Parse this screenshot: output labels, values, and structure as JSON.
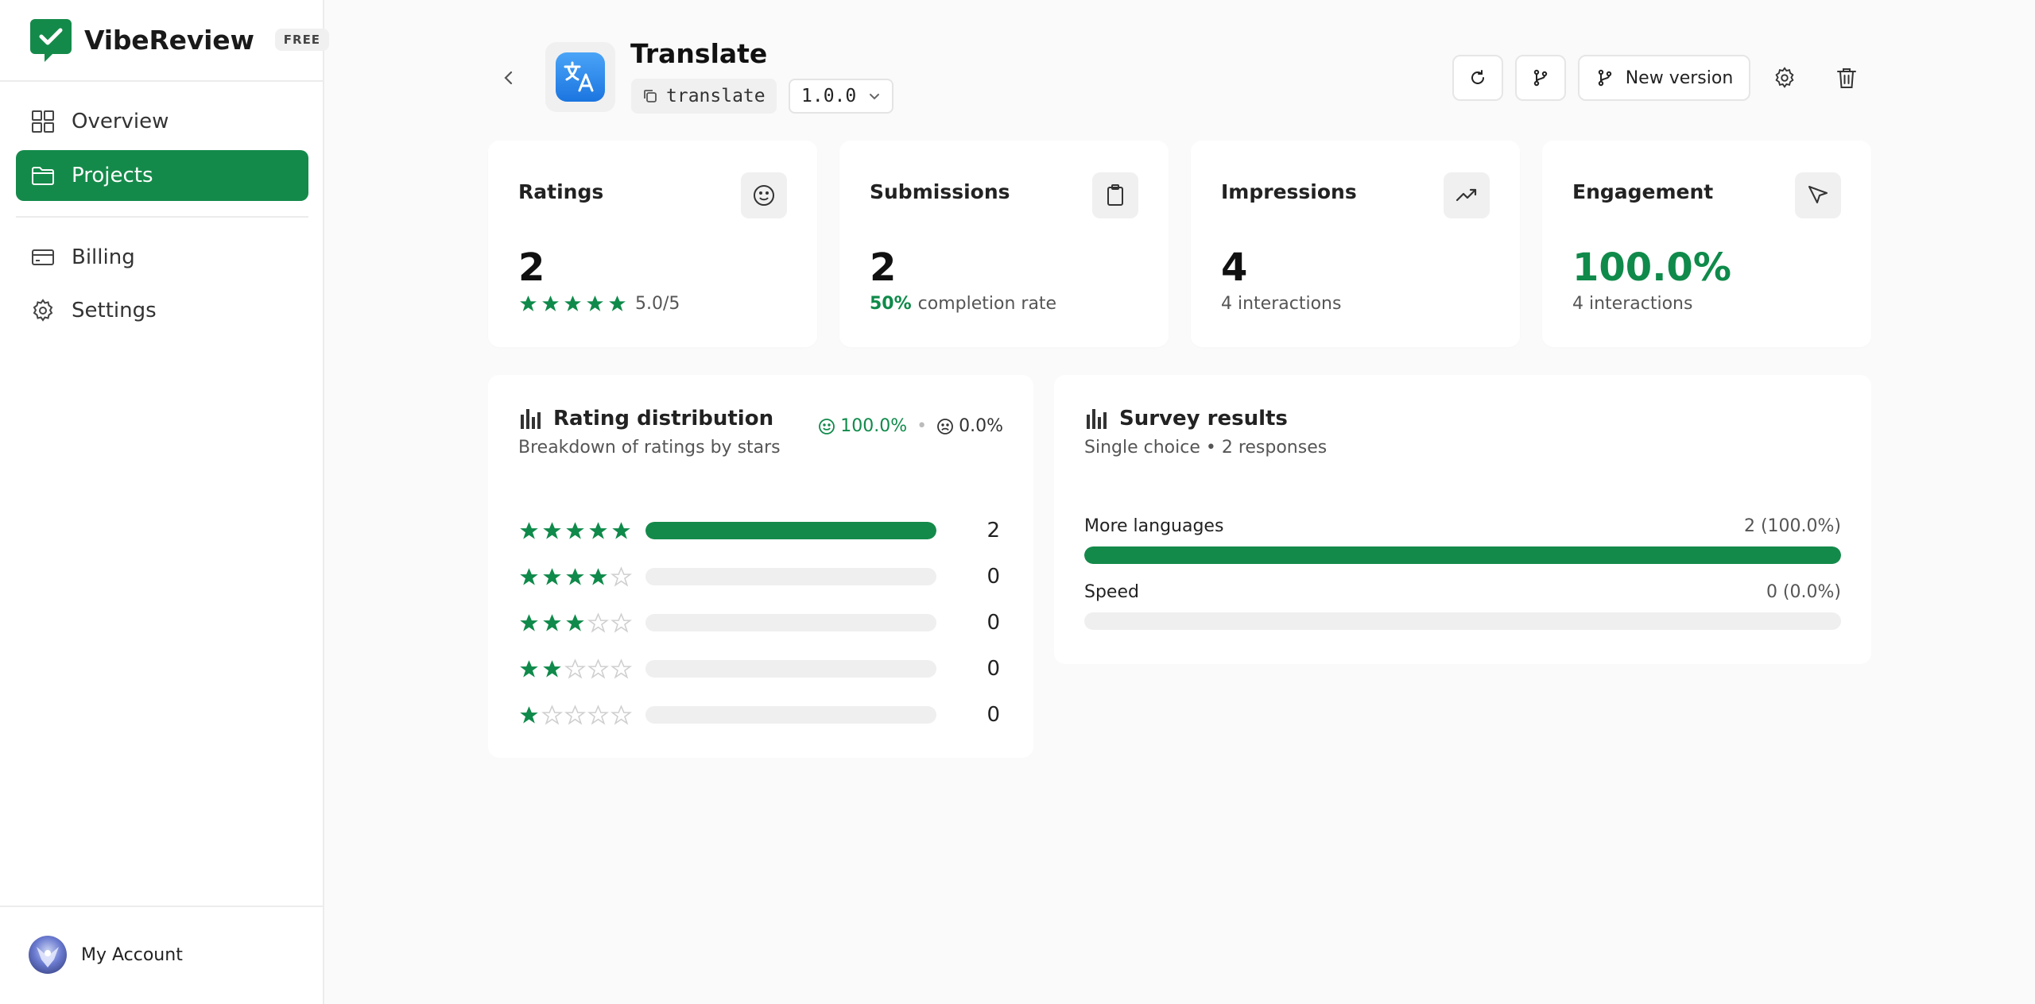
{
  "brand": {
    "name": "VibeReview",
    "plan_badge": "FREE"
  },
  "sidebar": {
    "items": [
      {
        "label": "Overview",
        "icon": "grid-icon"
      },
      {
        "label": "Projects",
        "icon": "folder-icon",
        "active": true
      },
      {
        "label": "Billing",
        "icon": "credit-card-icon"
      },
      {
        "label": "Settings",
        "icon": "gear-icon"
      }
    ],
    "account_label": "My Account"
  },
  "header": {
    "app_name": "Translate",
    "slug": "translate",
    "version": "1.0.0",
    "new_version_label": "New version"
  },
  "stats": {
    "ratings": {
      "title": "Ratings",
      "value": "2",
      "rating_text": "5.0/5",
      "stars": 5
    },
    "submissions": {
      "title": "Submissions",
      "value": "2",
      "rate": "50%",
      "rate_suffix": "completion rate"
    },
    "impressions": {
      "title": "Impressions",
      "value": "4",
      "sub": "4 interactions"
    },
    "engagement": {
      "title": "Engagement",
      "value": "100.0%",
      "sub": "4 interactions"
    }
  },
  "rating_distribution": {
    "title": "Rating distribution",
    "subtitle": "Breakdown of ratings by stars",
    "positive": "100.0%",
    "negative": "0.0%",
    "rows": [
      {
        "stars": 5,
        "count": "2",
        "fraction": 1.0
      },
      {
        "stars": 4,
        "count": "0",
        "fraction": 0
      },
      {
        "stars": 3,
        "count": "0",
        "fraction": 0
      },
      {
        "stars": 2,
        "count": "0",
        "fraction": 0
      },
      {
        "stars": 1,
        "count": "0",
        "fraction": 0
      }
    ]
  },
  "survey": {
    "title": "Survey results",
    "subtitle": "Single choice • 2 responses",
    "options": [
      {
        "label": "More languages",
        "value": "2 (100.0%)",
        "fraction": 1.0
      },
      {
        "label": "Speed",
        "value": "0 (0.0%)",
        "fraction": 0
      }
    ]
  },
  "colors": {
    "accent": "#148a4a",
    "accent_text": "#0f8a4a",
    "star": "#0f8a4a",
    "star_empty": "#cfcfcf"
  }
}
